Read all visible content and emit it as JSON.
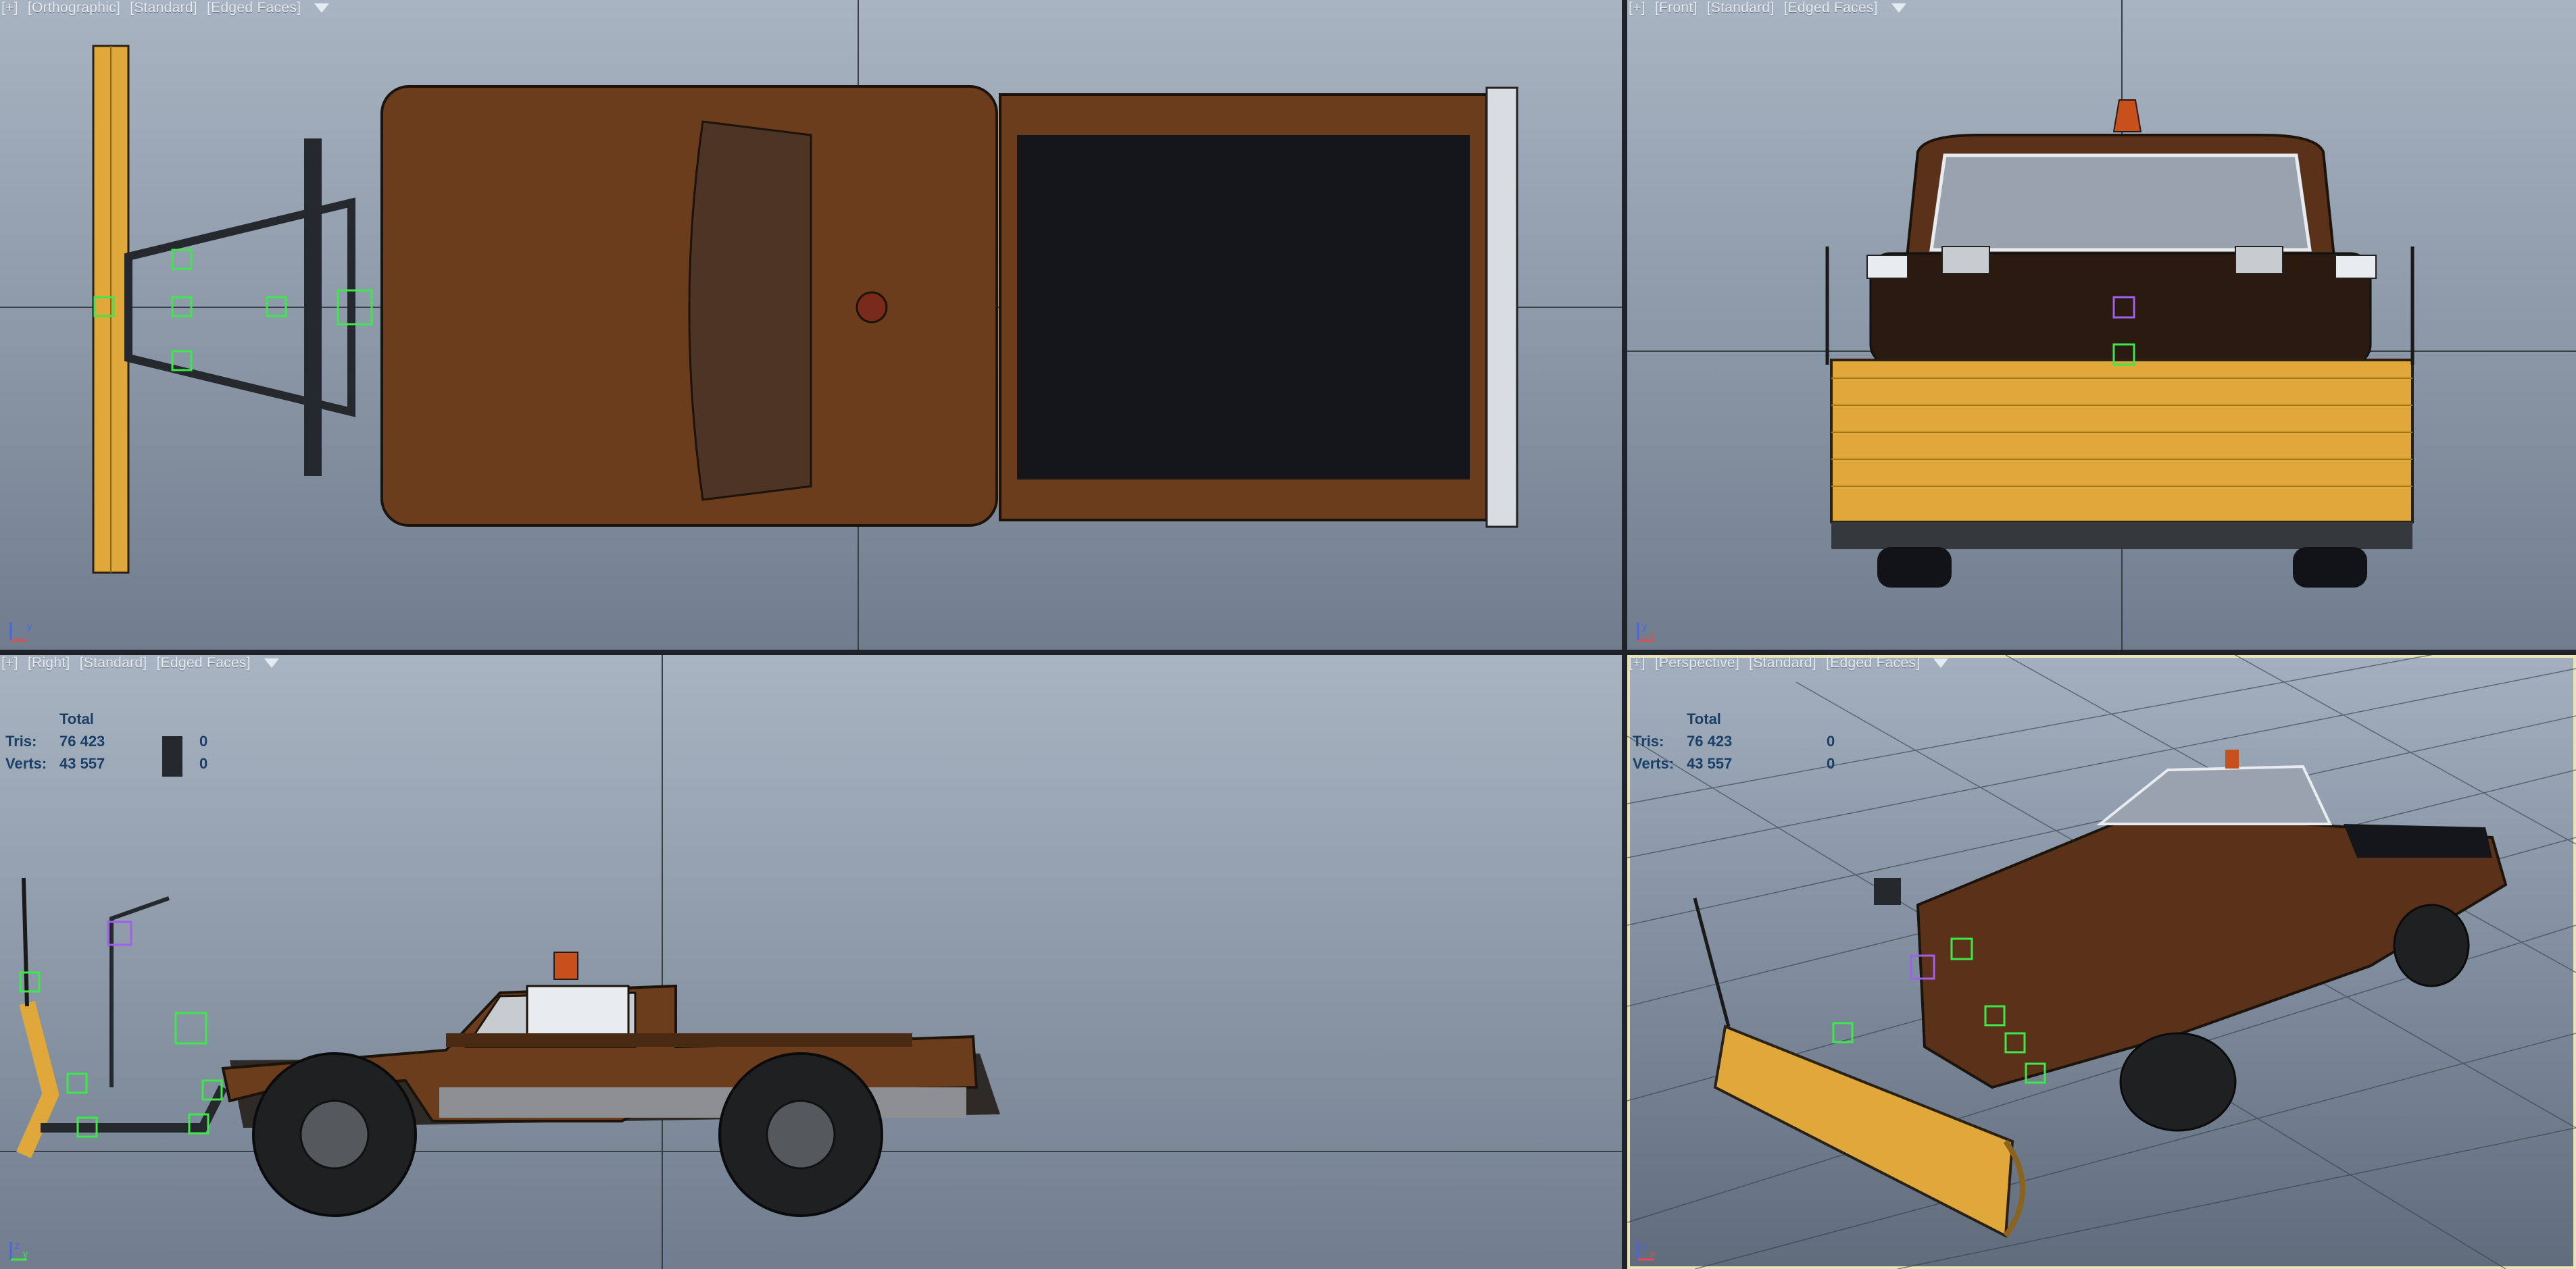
{
  "viewports": {
    "top": {
      "plus": "[+]",
      "view": "[Orthographic]",
      "shading": "[Standard]",
      "edges": "[Edged Faces]"
    },
    "front": {
      "plus": "[+]",
      "view": "[Front]",
      "shading": "[Standard]",
      "edges": "[Edged Faces]"
    },
    "right": {
      "plus": "[+]",
      "view": "[Right]",
      "shading": "[Standard]",
      "edges": "[Edged Faces]"
    },
    "perspective": {
      "plus": "[+]",
      "view": "[Perspective]",
      "shading": "[Standard]",
      "edges": "[Edged Faces]"
    }
  },
  "stats": {
    "header": "Total",
    "tris_label": "Tris:",
    "tris_value": "76 423",
    "tris_sel": "0",
    "verts_label": "Verts:",
    "verts_value": "43 557",
    "verts_sel": "0"
  },
  "axes": {
    "top": {
      "x": "x",
      "y": "y"
    },
    "front": {
      "x": "x",
      "y": "y"
    },
    "right": {
      "x": "y",
      "y": "z"
    },
    "perspective": {
      "x": "x",
      "y": "z"
    }
  },
  "colors": {
    "body_brown": "#6b3d1c",
    "plow_yellow": "#e0a83a",
    "helper_green": "#3ee84a",
    "stats_blue": "#1b3f66",
    "beacon_orange": "#c8501c"
  },
  "icons": {
    "filter": "filter-icon"
  }
}
